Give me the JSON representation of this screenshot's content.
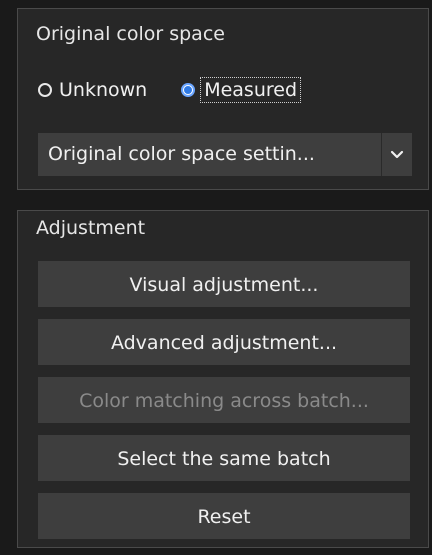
{
  "original_color_space": {
    "title": "Original color space",
    "radios": {
      "unknown": {
        "label": "Unknown",
        "checked": false
      },
      "measured": {
        "label": "Measured",
        "checked": true
      }
    },
    "settings_select": {
      "value": "Original color space settin...",
      "icon": "chevron-down-icon"
    }
  },
  "adjustment": {
    "title": "Adjustment",
    "buttons": {
      "visual": {
        "label": "Visual adjustment...",
        "enabled": true
      },
      "advanced": {
        "label": "Advanced adjustment...",
        "enabled": true
      },
      "color_matching": {
        "label": "Color matching across batch...",
        "enabled": false
      },
      "select_batch": {
        "label": "Select the same batch",
        "enabled": true
      },
      "reset": {
        "label": "Reset",
        "enabled": true
      }
    }
  },
  "colors": {
    "background": "#1a1a1a",
    "panel": "#272727",
    "panel_border": "#4a4a4a",
    "button": "#3e3e3e",
    "text": "#f0f0f0",
    "disabled_text": "#8a8a8a",
    "radio_accent": "#2f7ae5"
  }
}
